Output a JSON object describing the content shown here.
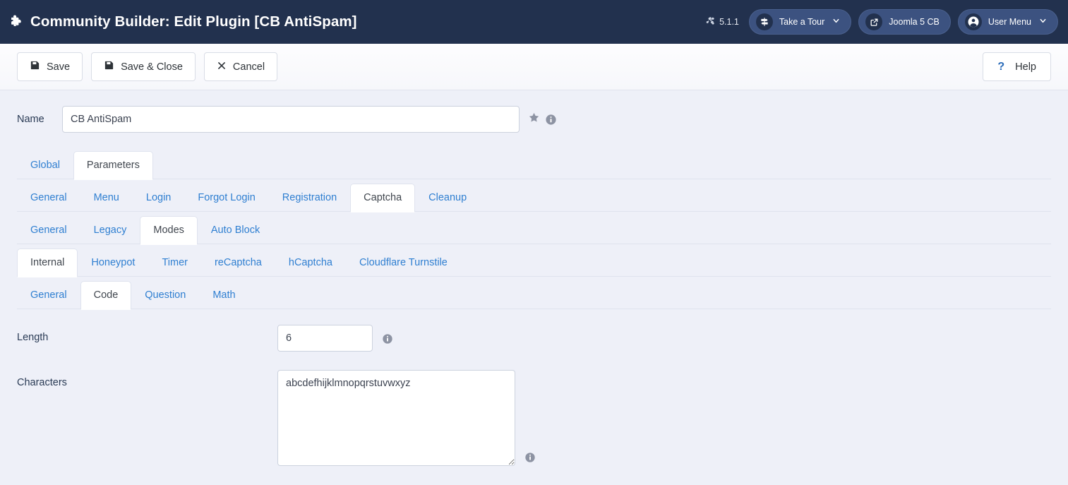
{
  "header": {
    "icon": "puzzle-piece-icon",
    "title": "Community Builder: Edit Plugin [CB AntiSpam]",
    "version_icon": "joomla-logo-icon",
    "version": "5.1.1",
    "buttons": [
      {
        "label": "Take a Tour",
        "icon": "signpost-icon",
        "chevron": true
      },
      {
        "label": "Joomla 5 CB",
        "icon": "external-link-icon",
        "chevron": false
      },
      {
        "label": "User Menu",
        "icon": "user-circle-icon",
        "chevron": true
      }
    ]
  },
  "toolbar": {
    "save_label": "Save",
    "save_close_label": "Save & Close",
    "cancel_label": "Cancel",
    "help_label": "Help",
    "help_glyph": "?"
  },
  "name_field": {
    "label": "Name",
    "value": "CB AntiSpam",
    "placeholder": "",
    "star_icon": "star-icon",
    "info_icon": "info-icon"
  },
  "tab_rows": [
    {
      "name": "primary-tabs",
      "tabs": [
        {
          "label": "Global",
          "active": false
        },
        {
          "label": "Parameters",
          "active": true
        }
      ]
    },
    {
      "name": "parameters-tabs",
      "tabs": [
        {
          "label": "General",
          "active": false
        },
        {
          "label": "Menu",
          "active": false
        },
        {
          "label": "Login",
          "active": false
        },
        {
          "label": "Forgot Login",
          "active": false
        },
        {
          "label": "Registration",
          "active": false
        },
        {
          "label": "Captcha",
          "active": true
        },
        {
          "label": "Cleanup",
          "active": false
        }
      ]
    },
    {
      "name": "captcha-tabs",
      "tabs": [
        {
          "label": "General",
          "active": false
        },
        {
          "label": "Legacy",
          "active": false
        },
        {
          "label": "Modes",
          "active": true
        },
        {
          "label": "Auto Block",
          "active": false
        }
      ]
    },
    {
      "name": "modes-tabs",
      "tabs": [
        {
          "label": "Internal",
          "active": true
        },
        {
          "label": "Honeypot",
          "active": false
        },
        {
          "label": "Timer",
          "active": false
        },
        {
          "label": "reCaptcha",
          "active": false
        },
        {
          "label": "hCaptcha",
          "active": false
        },
        {
          "label": "Cloudflare Turnstile",
          "active": false
        }
      ]
    },
    {
      "name": "internal-tabs",
      "tabs": [
        {
          "label": "General",
          "active": false
        },
        {
          "label": "Code",
          "active": true
        },
        {
          "label": "Question",
          "active": false
        },
        {
          "label": "Math",
          "active": false
        }
      ]
    }
  ],
  "form": {
    "length": {
      "label": "Length",
      "value": "6",
      "placeholder": "",
      "info_icon": "info-icon"
    },
    "characters": {
      "label": "Characters",
      "value": "abcdefhijklmnopqrstuvwxyz",
      "placeholder": "",
      "info_icon": "info-icon"
    }
  },
  "colors": {
    "header_bg": "#22314e",
    "page_bg": "#eef0f8",
    "link_blue": "#2f7fd1",
    "accent_blue": "#2b6cb9",
    "chip_bg": "#3c5280"
  }
}
